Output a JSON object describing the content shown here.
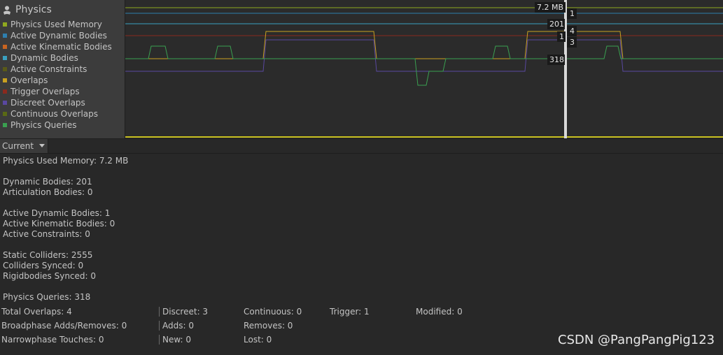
{
  "legend": {
    "title": "Physics",
    "icon": "physics-icon",
    "items": [
      {
        "label": "Physics Used Memory",
        "color": "#8fa81f"
      },
      {
        "label": "Active Dynamic Bodies",
        "color": "#2e7fae"
      },
      {
        "label": "Active Kinematic Bodies",
        "color": "#c86420"
      },
      {
        "label": "Dynamic Bodies",
        "color": "#3aa0c0"
      },
      {
        "label": "Active Constraints",
        "color": "#5a5a18"
      },
      {
        "label": "Overlaps",
        "color": "#c8a020"
      },
      {
        "label": "Trigger Overlaps",
        "color": "#8a2a1e"
      },
      {
        "label": "Discreet Overlaps",
        "color": "#5a48a0"
      },
      {
        "label": "Continuous Overlaps",
        "color": "#5a6a14"
      },
      {
        "label": "Physics Queries",
        "color": "#3aa050"
      }
    ]
  },
  "chart": {
    "badges": {
      "memory": "7.2 MB",
      "active_dynamic": "1",
      "dynamic_bodies": "201",
      "overlaps": "4",
      "active_kinematic": "1",
      "discreet": "3",
      "queries": "318"
    }
  },
  "current": {
    "label": "Current"
  },
  "details": {
    "memory": "Physics Used Memory: 7.2 MB",
    "dynamic_bodies": "Dynamic Bodies: 201",
    "articulation_bodies": "Articulation Bodies: 0",
    "active_dynamic": "Active Dynamic Bodies: 1",
    "active_kinematic": "Active Kinematic Bodies: 0",
    "active_constraints": "Active Constraints: 0",
    "static_colliders": "Static Colliders: 2555",
    "colliders_synced": "Colliders Synced: 0",
    "rigidbodies_synced": "Rigidbodies Synced: 0",
    "physics_queries": "Physics Queries: 318"
  },
  "overlaps_table": {
    "total_overlaps": "Total Overlaps: 4",
    "discreet": "Discreet: 3",
    "continuous": "Continuous: 0",
    "trigger": "Trigger: 1",
    "modified": "Modified: 0",
    "broadphase": "Broadphase Adds/Removes: 0",
    "adds": "Adds: 0",
    "removes": "Removes: 0",
    "narrowphase": "Narrowphase Touches: 0",
    "new": "New: 0",
    "lost": "Lost: 0"
  },
  "watermark": "CSDN @PangPangPig123"
}
